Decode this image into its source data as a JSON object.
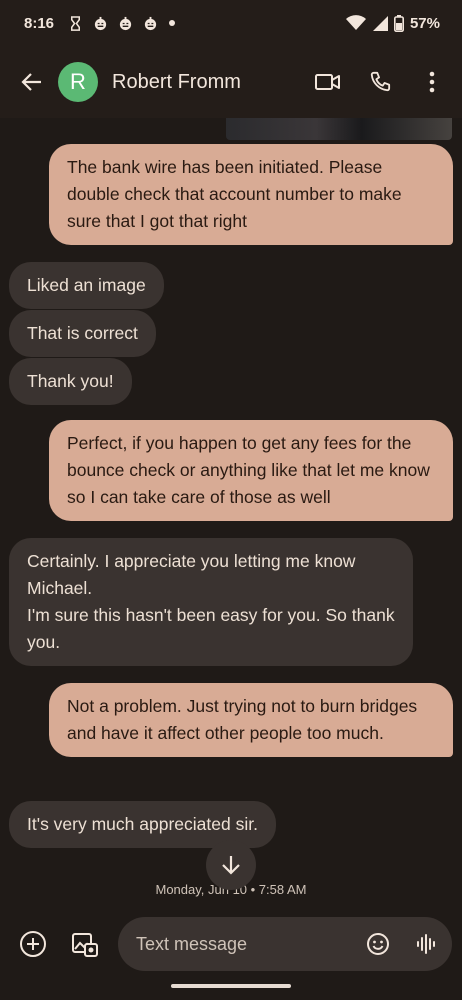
{
  "status": {
    "time": "8:16",
    "battery": "57%",
    "icons": [
      "hourglass-icon",
      "jack-o-lantern-icon",
      "jack-o-lantern-icon",
      "jack-o-lantern-icon",
      "dot-icon",
      "wifi-icon",
      "signal-icon",
      "battery-icon"
    ]
  },
  "header": {
    "avatar_letter": "R",
    "contact_name": "Robert Fromm",
    "avatar_color": "#5bb974"
  },
  "messages": [
    {
      "direction": "outgoing",
      "text": "The bank wire has been initiated. Please double check that account number to make sure that I got that right"
    },
    {
      "direction": "incoming",
      "text": "Liked an image"
    },
    {
      "direction": "incoming",
      "text": "That is correct"
    },
    {
      "direction": "incoming",
      "text": "Thank you!"
    },
    {
      "direction": "outgoing",
      "text": "Perfect, if you happen to get any fees for the bounce check or anything like that let me know so I can take care of those as well"
    },
    {
      "direction": "incoming",
      "text": "Certainly. I appreciate you letting me know Michael.\nI'm sure this hasn't been easy for you. So thank you."
    },
    {
      "direction": "outgoing",
      "text": "Not a problem. Just trying not to burn bridges and have it affect other people too much."
    },
    {
      "direction": "incoming",
      "text": "It's very much appreciated sir."
    }
  ],
  "timestamp": "Monday, Jun 10 • 7:58 AM",
  "compose": {
    "placeholder": "Text message"
  },
  "colors": {
    "background": "#1f1a17",
    "outgoing_bubble": "#d8ab95",
    "incoming_bubble": "#3a3330"
  }
}
